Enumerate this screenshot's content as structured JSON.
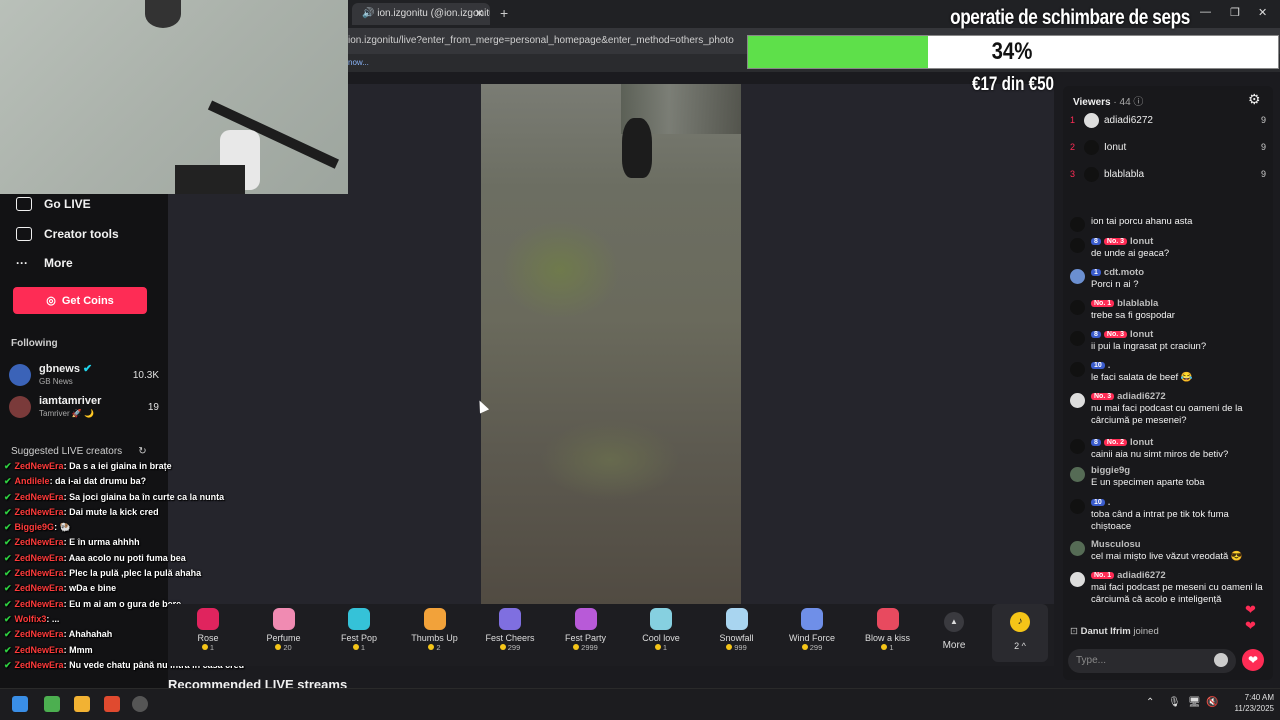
{
  "browser": {
    "tab_title": "ion.izgonitu (@ion.izgonitu) i",
    "url": "ion.izgonitu/live?enter_from_merge=personal_homepage&enter_method=others_photo",
    "bookmark_text": "now..."
  },
  "donation": {
    "title": "operatie de schimbare de seps",
    "percent": 34,
    "percent_label": "34%",
    "goal_label": "€17 din €50"
  },
  "sidebar": {
    "items": [
      {
        "label": "Go LIVE",
        "icon": "camera-icon"
      },
      {
        "label": "Creator tools",
        "icon": "house-icon"
      },
      {
        "label": "More",
        "icon": "ellipsis-icon"
      }
    ],
    "get_coins": "Get Coins",
    "following_title": "Following",
    "following": [
      {
        "name": "gbnews",
        "sub": "GB News",
        "count": "10.3K"
      },
      {
        "name": "iamtamriver",
        "sub": "Tamriver 🚀 🌙",
        "count": "19"
      }
    ],
    "suggested_title": "Suggested LIVE creators"
  },
  "overlay_chat": [
    {
      "user": "ZedNewEra",
      "msg": ": Da s a iei giaina in brațe"
    },
    {
      "user": "Andilele",
      "msg": ": da i-ai dat drumu ba?"
    },
    {
      "user": "ZedNewEra",
      "msg": ": Sa joci giaina ba în curte ca la nunta"
    },
    {
      "user": "ZedNewEra",
      "msg": ": Dai mute la kick cred"
    },
    {
      "user": "Biggie9G",
      "msg": ": 🐏",
      "check": true
    },
    {
      "user": "ZedNewEra",
      "msg": ": E în urma ahhhh"
    },
    {
      "user": "ZedNewEra",
      "msg": ": Aaa acolo nu poti fuma bea"
    },
    {
      "user": "ZedNewEra",
      "msg": ": Plec la pulă ,plec la pulă ahaha"
    },
    {
      "user": "ZedNewEra",
      "msg": ": wDa e bine"
    },
    {
      "user": "ZedNewEra",
      "msg": ": Eu m ai am o gura de bere"
    },
    {
      "user": "Wolfix3",
      "msg": ": ..."
    },
    {
      "user": "ZedNewEra",
      "msg": ": Ahahahah"
    },
    {
      "user": "ZedNewEra",
      "msg": ": Mmm"
    },
    {
      "user": "ZedNewEra",
      "msg": ": Nu vede chatu până nu intră în casa cred"
    }
  ],
  "recommended_title": "Recommended LIVE streams",
  "viewers": {
    "title": "Viewers",
    "count": "· 44",
    "top": [
      {
        "rank": "1",
        "name": "adiadi6272",
        "score": "9"
      },
      {
        "rank": "2",
        "name": "Ionut",
        "score": "9"
      },
      {
        "rank": "3",
        "name": "blablabla",
        "score": "9"
      }
    ]
  },
  "chat": [
    {
      "user": "",
      "badges": [],
      "msg": "ion tai porcu ahanu asta"
    },
    {
      "user": "Ionut",
      "badges": [
        "8",
        "No. 3"
      ],
      "msg": "de unde ai geaca?"
    },
    {
      "user": "cdt.moto",
      "badges": [
        "1"
      ],
      "msg": "Porci n ai ?"
    },
    {
      "user": "blablabla",
      "badges": [
        "No. 1"
      ],
      "msg": "trebe sa fi gospodar"
    },
    {
      "user": "Ionut",
      "badges": [
        "8",
        "No. 3"
      ],
      "msg": "ii pui la ingrasat pt craciun?"
    },
    {
      "user": ".",
      "badges": [
        "10"
      ],
      "msg": "le faci salata de beef 😂"
    },
    {
      "user": "adiadi6272",
      "badges": [
        "No. 3"
      ],
      "msg": "nu mai faci podcast cu oameni de la cârciumă pe mesenei?"
    },
    {
      "user": "Ionut",
      "badges": [
        "8",
        "No. 2"
      ],
      "msg": "cainii aia nu simt miros de betiv?"
    },
    {
      "user": "biggie9g",
      "badges": [],
      "msg": "E un specimen aparte toba"
    },
    {
      "user": ".",
      "badges": [
        "10"
      ],
      "msg": "toba când a intrat pe tik tok fuma chiștoace"
    },
    {
      "user": "Musculosu",
      "badges": [],
      "msg": "cel mai mișto live văzut vreodată 😎"
    },
    {
      "user": "adiadi6272",
      "badges": [
        "No. 1"
      ],
      "msg": "mai faci podcast pe meseni cu oameni la cârciumă că acolo e inteligență"
    }
  ],
  "joined": {
    "user": "Danut Ifrim",
    "text": "joined"
  },
  "input_placeholder": "Type...",
  "gifts": [
    {
      "name": "Rose",
      "price": "1",
      "color": "#e0245e"
    },
    {
      "name": "Perfume",
      "price": "20",
      "color": "#f08bb2"
    },
    {
      "name": "Fest Pop",
      "price": "1",
      "color": "#35c2d8"
    },
    {
      "name": "Thumbs Up",
      "price": "2",
      "color": "#f2a23a"
    },
    {
      "name": "Fest Cheers",
      "price": "299",
      "color": "#7f6fe0"
    },
    {
      "name": "Fest Party",
      "price": "2999",
      "color": "#b85ad8"
    },
    {
      "name": "Cool love",
      "price": "1",
      "color": "#86d0e0"
    },
    {
      "name": "Snowfall",
      "price": "999",
      "color": "#a9d5f0"
    },
    {
      "name": "Wind Force",
      "price": "299",
      "color": "#6f8fe8"
    },
    {
      "name": "Blow a kiss",
      "price": "1",
      "color": "#e84a5f"
    }
  ],
  "more_label": "More",
  "gift_panel_count": "2",
  "clock": {
    "time": "7:40 AM",
    "date": "11/23/2025"
  }
}
